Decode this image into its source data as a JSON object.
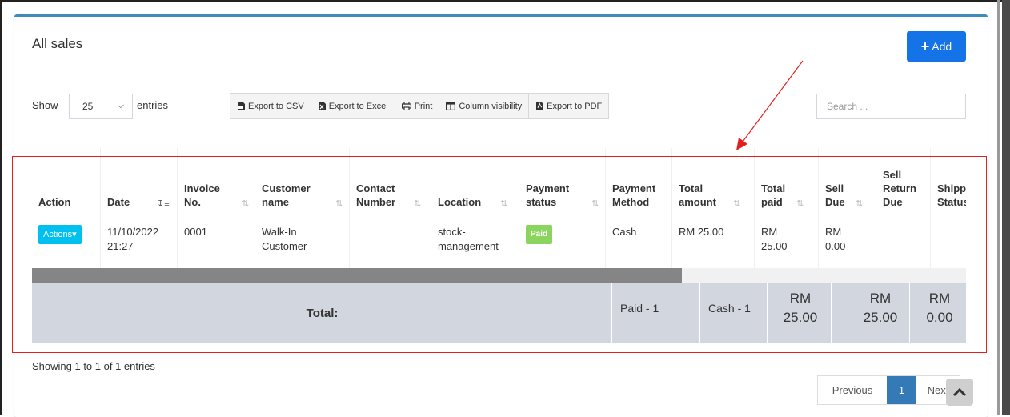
{
  "panel": {
    "title": "All sales",
    "add_label": "Add"
  },
  "length": {
    "show_label": "Show",
    "value": "25",
    "entries_label": "entries"
  },
  "export_buttons": [
    {
      "label": "Export to CSV",
      "icon": "csv-file-icon"
    },
    {
      "label": "Export to Excel",
      "icon": "excel-file-icon"
    },
    {
      "label": "Print",
      "icon": "printer-icon"
    },
    {
      "label": "Column visibility",
      "icon": "columns-icon"
    },
    {
      "label": "Export to PDF",
      "icon": "pdf-file-icon"
    }
  ],
  "search": {
    "placeholder": "Search ..."
  },
  "table": {
    "headers": [
      "Action",
      "Date",
      "Invoice No.",
      "Customer name",
      "Contact Number",
      "Location",
      "Payment status",
      "Payment Method",
      "Total amount",
      "Total paid",
      "Sell Due",
      "Sell Return Due",
      "Shipping Status"
    ],
    "row": {
      "action": "Actions",
      "date": "11/10/2022 21:27",
      "invoice": "0001",
      "customer": "Walk-In Customer",
      "contact": "",
      "location": "stock-management",
      "payment_status": "Paid",
      "payment_method": "Cash",
      "total_amount": "RM 25.00",
      "total_paid": "RM 25.00",
      "sell_due": "RM 0.00"
    },
    "footer": {
      "label": "Total:",
      "paid_count": "Paid - 1",
      "cash_count": "Cash - 1",
      "total_amount": "RM 25.00",
      "total_paid": "RM 25.00",
      "sell_due": "RM 0.00"
    }
  },
  "info": "Showing 1 to 1 of 1 entries",
  "pagination": {
    "previous": "Previous",
    "current": "1",
    "next": "Next"
  },
  "colors": {
    "primary": "#1473e6",
    "info": "#00c0ef",
    "success": "#8bd45e",
    "annotation": "#e02020"
  }
}
